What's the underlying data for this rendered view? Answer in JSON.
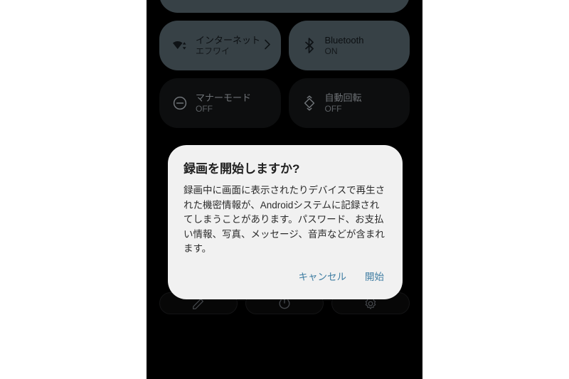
{
  "theme": {
    "page_background": "#ffffff",
    "screen_background": "#000000",
    "tile_on_color": "#4d5a62",
    "tile_off_color": "#131415",
    "dialog_background": "#f1f1f1",
    "dialog_title_color": "#1f1f1f",
    "dialog_body_color": "#2b2b2b",
    "dialog_action_color": "#3f7da2"
  },
  "quick_settings": {
    "rows": [
      {
        "tiles": [
          {
            "name": "partial-top-tile",
            "icon": "",
            "label": "",
            "sub": "",
            "state": "on",
            "wide": true,
            "chevron": false
          }
        ]
      },
      {
        "tiles": [
          {
            "name": "internet",
            "icon": "wifi-icon",
            "label": "インターネット",
            "sub": "エフワイ",
            "state": "on",
            "wide": false,
            "chevron": true
          },
          {
            "name": "bluetooth",
            "icon": "bluetooth-icon",
            "label": "Bluetooth",
            "sub": "ON",
            "state": "on",
            "wide": false,
            "chevron": false
          }
        ]
      },
      {
        "tiles": [
          {
            "name": "silent-mode",
            "icon": "do-not-disturb-icon",
            "label": "マナーモード",
            "sub": "OFF",
            "state": "off",
            "wide": false,
            "chevron": false
          },
          {
            "name": "auto-rotate",
            "icon": "auto-rotate-icon",
            "label": "自動回転",
            "sub": "OFF",
            "state": "off",
            "wide": false,
            "chevron": false
          }
        ]
      }
    ],
    "footer_buttons": [
      {
        "name": "edit-tiles-button",
        "icon": "pencil-icon"
      },
      {
        "name": "power-button",
        "icon": "power-icon"
      },
      {
        "name": "settings-button",
        "icon": "gear-icon"
      }
    ]
  },
  "dialog": {
    "title": "録画を開始しますか?",
    "body": "録画中に画面に表示されたりデバイスで再生された機密情報が、Androidシステムに記録されてしまうことがあります。パスワード、お支払い情報、写真、メッセージ、音声などが含まれます。",
    "cancel_label": "キャンセル",
    "confirm_label": "開始"
  }
}
